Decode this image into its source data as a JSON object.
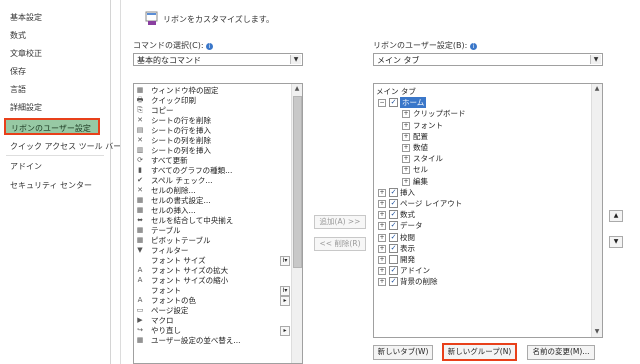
{
  "sidebar": {
    "items": [
      {
        "label": "基本設定"
      },
      {
        "label": "数式"
      },
      {
        "label": "文章校正"
      },
      {
        "label": "保存"
      },
      {
        "label": "言語"
      },
      {
        "label": "詳細設定"
      },
      {
        "label": "リボンのユーザー設定"
      },
      {
        "label": "クイック アクセス ツール バー"
      },
      {
        "label": "アドイン"
      },
      {
        "label": "セキュリティ センター"
      }
    ]
  },
  "main": {
    "header_title": "リボンをカスタマイズします。",
    "commands_label": "コマンドの選択(C):",
    "commands_select_value": "基本的なコマンド",
    "ribbon_label": "リボンのユーザー設定(B):",
    "ribbon_select_value": "メイン タブ",
    "commands": [
      {
        "icon": "window-freeze-icon",
        "glyph": "▦",
        "label": "ウィンドウ枠の固定",
        "sub": ""
      },
      {
        "icon": "quick-print-icon",
        "glyph": "🖶",
        "label": "クイック印刷",
        "sub": ""
      },
      {
        "icon": "copy-icon",
        "glyph": "⎘",
        "label": "コピー",
        "sub": ""
      },
      {
        "icon": "delete-rows-icon",
        "glyph": "✕",
        "label": "シートの行を削除",
        "sub": ""
      },
      {
        "icon": "insert-rows-icon",
        "glyph": "▤",
        "label": "シートの行を挿入",
        "sub": ""
      },
      {
        "icon": "delete-columns-icon",
        "glyph": "✕",
        "label": "シートの列を削除",
        "sub": ""
      },
      {
        "icon": "insert-columns-icon",
        "glyph": "▥",
        "label": "シートの列を挿入",
        "sub": ""
      },
      {
        "icon": "refresh-all-icon",
        "glyph": "⟳",
        "label": "すべて更新",
        "sub": ""
      },
      {
        "icon": "chart-types-icon",
        "glyph": "▮",
        "label": "すべてのグラフの種類...",
        "sub": ""
      },
      {
        "icon": "spell-check-icon",
        "glyph": "✔",
        "label": "スペル チェック...",
        "sub": ""
      },
      {
        "icon": "delete-cells-icon",
        "glyph": "✕",
        "label": "セルの削除...",
        "sub": ""
      },
      {
        "icon": "format-cells-icon",
        "glyph": "▦",
        "label": "セルの書式設定...",
        "sub": ""
      },
      {
        "icon": "insert-cells-icon",
        "glyph": "▦",
        "label": "セルの挿入...",
        "sub": ""
      },
      {
        "icon": "merge-center-icon",
        "glyph": "⬌",
        "label": "セルを結合して中央揃え",
        "sub": ""
      },
      {
        "icon": "table-icon",
        "glyph": "▦",
        "label": "テーブル",
        "sub": ""
      },
      {
        "icon": "pivot-table-icon",
        "glyph": "▦",
        "label": "ピボットテーブル",
        "sub": ""
      },
      {
        "icon": "filter-icon",
        "glyph": "▼",
        "label": "フィルター",
        "sub": ""
      },
      {
        "icon": "font-size-icon",
        "glyph": "",
        "label": "フォント サイズ",
        "sub": "I▾"
      },
      {
        "icon": "font-grow-icon",
        "glyph": "A",
        "label": "フォント サイズの拡大",
        "sub": ""
      },
      {
        "icon": "font-shrink-icon",
        "glyph": "A",
        "label": "フォント サイズの縮小",
        "sub": ""
      },
      {
        "icon": "font-icon",
        "glyph": "",
        "label": "フォント",
        "sub": "I▾"
      },
      {
        "icon": "font-color-icon",
        "glyph": "A",
        "label": "フォントの色",
        "sub": "▸"
      },
      {
        "icon": "page-setup-icon",
        "glyph": "▭",
        "label": "ページ設定",
        "sub": ""
      },
      {
        "icon": "macro-icon",
        "glyph": "▶",
        "label": "マクロ",
        "sub": ""
      },
      {
        "icon": "redo-icon",
        "glyph": "↪",
        "label": "やり直し",
        "sub": "▸"
      },
      {
        "icon": "user-defined-icon",
        "glyph": "▦",
        "label": "ユーザー設定の並べ替え...",
        "sub": ""
      }
    ],
    "add_button": "追加(A) >>",
    "remove_button": "<< 削除(R)",
    "tree": [
      {
        "level": 0,
        "expander": "",
        "check": false,
        "has_check": false,
        "label": "メイン タブ",
        "selected": false
      },
      {
        "level": 1,
        "expander": "−",
        "check": true,
        "has_check": true,
        "label": "ホーム",
        "selected": true
      },
      {
        "level": 2,
        "expander": "+",
        "check": false,
        "has_check": false,
        "label": "クリップボード",
        "selected": false
      },
      {
        "level": 2,
        "expander": "+",
        "check": false,
        "has_check": false,
        "label": "フォント",
        "selected": false
      },
      {
        "level": 2,
        "expander": "+",
        "check": false,
        "has_check": false,
        "label": "配置",
        "selected": false
      },
      {
        "level": 2,
        "expander": "+",
        "check": false,
        "has_check": false,
        "label": "数値",
        "selected": false
      },
      {
        "level": 2,
        "expander": "+",
        "check": false,
        "has_check": false,
        "label": "スタイル",
        "selected": false
      },
      {
        "level": 2,
        "expander": "+",
        "check": false,
        "has_check": false,
        "label": "セル",
        "selected": false
      },
      {
        "level": 2,
        "expander": "+",
        "check": false,
        "has_check": false,
        "label": "編集",
        "selected": false
      },
      {
        "level": 1,
        "expander": "+",
        "check": true,
        "has_check": true,
        "label": "挿入",
        "selected": false
      },
      {
        "level": 1,
        "expander": "+",
        "check": true,
        "has_check": true,
        "label": "ページ レイアウト",
        "selected": false
      },
      {
        "level": 1,
        "expander": "+",
        "check": true,
        "has_check": true,
        "label": "数式",
        "selected": false
      },
      {
        "level": 1,
        "expander": "+",
        "check": true,
        "has_check": true,
        "label": "データ",
        "selected": false
      },
      {
        "level": 1,
        "expander": "+",
        "check": true,
        "has_check": true,
        "label": "校閲",
        "selected": false
      },
      {
        "level": 1,
        "expander": "+",
        "check": true,
        "has_check": true,
        "label": "表示",
        "selected": false
      },
      {
        "level": 1,
        "expander": "+",
        "check": false,
        "has_check": true,
        "label": "開発",
        "selected": false
      },
      {
        "level": 1,
        "expander": "+",
        "check": true,
        "has_check": true,
        "label": "アドイン",
        "selected": false
      },
      {
        "level": 1,
        "expander": "+",
        "check": true,
        "has_check": true,
        "label": "背景の削除",
        "selected": false
      }
    ],
    "new_tab_button": "新しいタブ(W)",
    "new_group_button": "新しいグループ(N)",
    "rename_button": "名前の変更(M)...",
    "move_up": "▲",
    "move_down": "▼"
  },
  "colors": {
    "selected_sidebar_bg": "#97c9a4",
    "highlight_border": "#e8401a",
    "tree_selection": "#3a77c9"
  }
}
